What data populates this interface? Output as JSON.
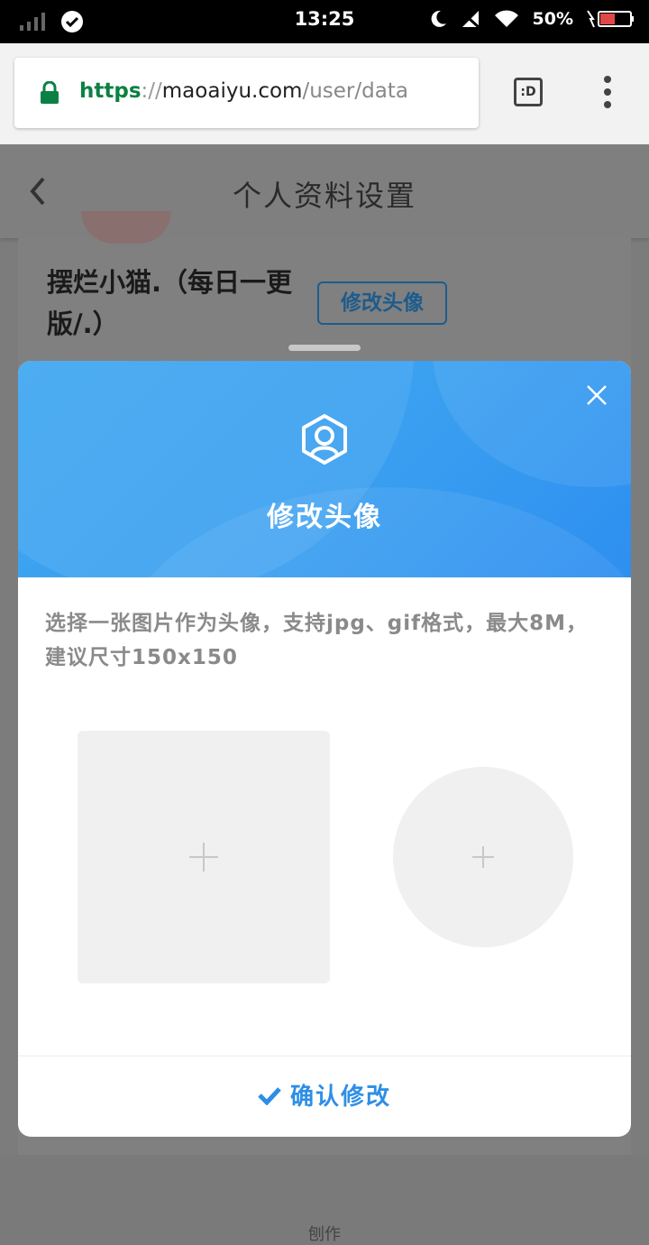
{
  "status_bar": {
    "time": "13:25",
    "battery": "50%"
  },
  "browser": {
    "url_scheme": "https",
    "url_sep": "://",
    "url_host": "maoaiyu.com",
    "url_path": "/user/data",
    "tab_label": ":D"
  },
  "page": {
    "title": "个人资料设置",
    "username": "摆烂小猫.（每日一更版/.）",
    "change_avatar_label": "修改头像",
    "bottom_label": "刨作"
  },
  "modal": {
    "title": "修改头像",
    "description": "选择一张图片作为头像，支持jpg、gif格式，最大8M，建议尺寸150x150",
    "confirm_label": "确认修改"
  },
  "colors": {
    "accent": "#2d8ee6",
    "hero_blue": "#3ea6f0",
    "url_green": "#0b8043"
  }
}
